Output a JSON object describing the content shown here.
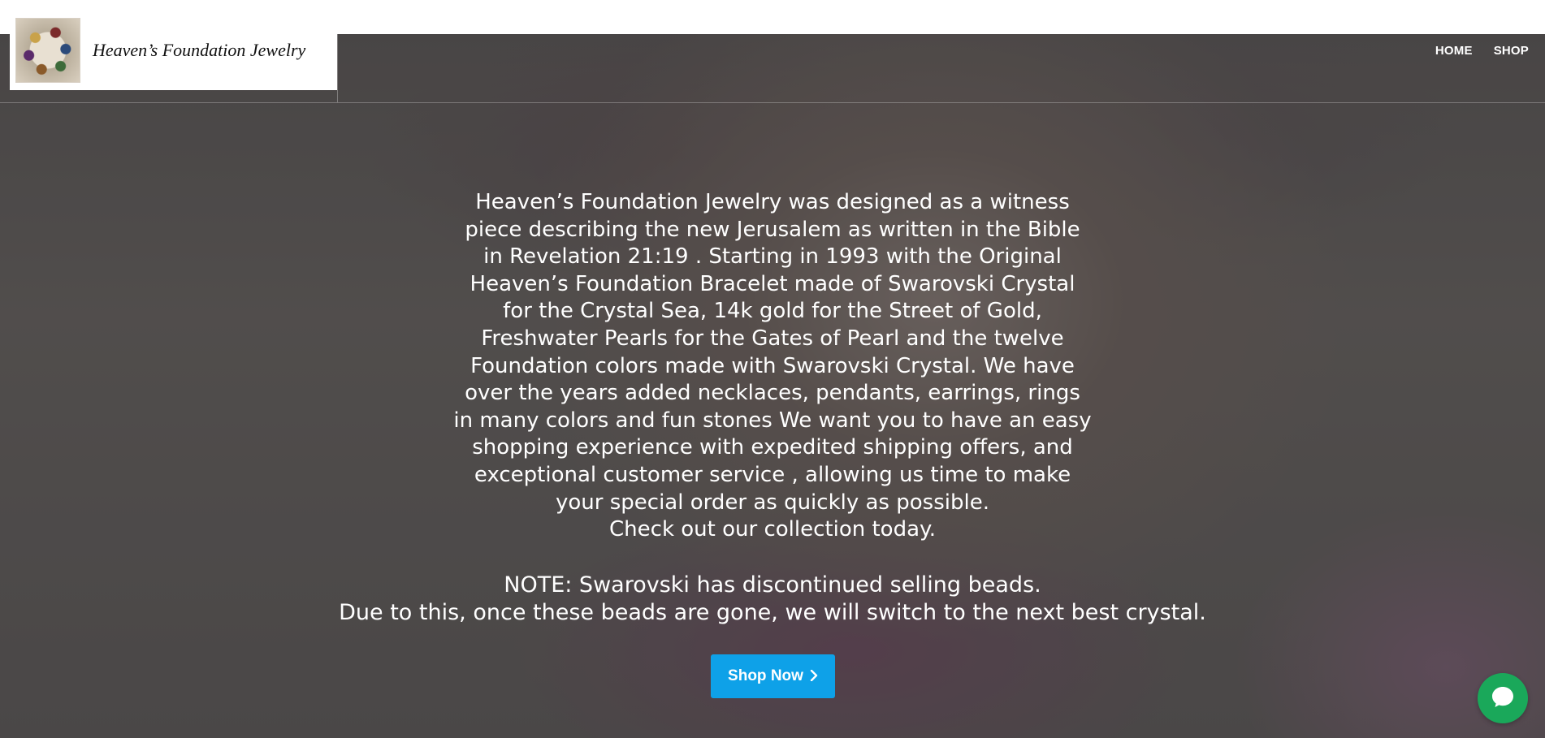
{
  "brand": {
    "name": "Heaven’s Foundation Jewelry"
  },
  "nav": {
    "items": [
      {
        "label": "HOME"
      },
      {
        "label": "SHOP"
      }
    ]
  },
  "hero": {
    "intro_lines": [
      "Heaven’s Foundation Jewelry was designed as a witness",
      "piece describing the new Jerusalem as written in the Bible",
      "in Revelation 21:19 . Starting in 1993 with the Original",
      "Heaven’s Foundation Bracelet made of Swarovski Crystal",
      "for the Crystal Sea, 14k gold for the Street of Gold,",
      "Freshwater Pearls for the Gates of Pearl and the twelve",
      "Foundation colors made with Swarovski Crystal. We have",
      "over the years added necklaces, pendants, earrings, rings",
      "in many colors and fun stones We want you to have an easy",
      "shopping experience with expedited shipping offers, and",
      "exceptional customer service , allowing us time to make",
      "your special order as quickly as possible.",
      "Check out our collection today."
    ],
    "note_line_1": "NOTE: Swarovski has discontinued selling beads.",
    "note_line_2": "Due to this, once these beads are gone, we will switch to the next best crystal.",
    "cta_label": "Shop Now"
  },
  "icons": {
    "cta": "chevron-right-icon",
    "chat": "chat-bubble-icon"
  },
  "colors": {
    "cta": "#0ea1e8",
    "chat": "#1aa85a"
  }
}
